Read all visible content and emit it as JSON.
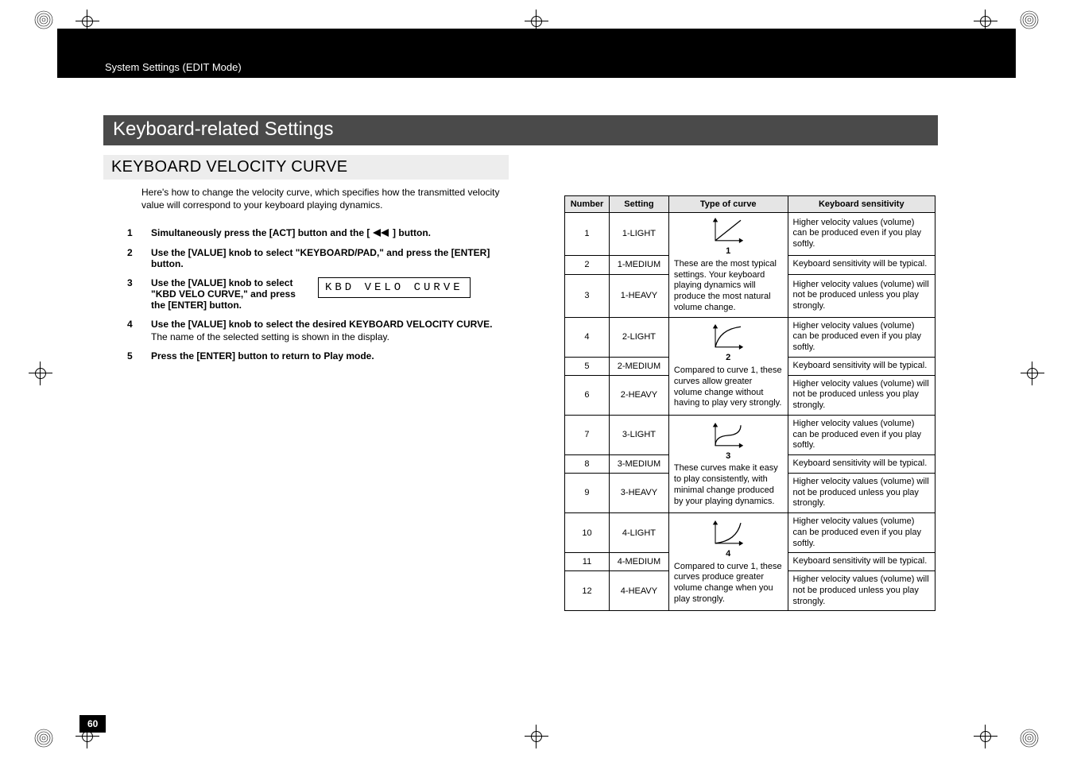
{
  "header": {
    "breadcrumb": "System Settings (EDIT Mode)"
  },
  "title": "Keyboard-related Settings",
  "section": "KEYBOARD VELOCITY CURVE",
  "intro": "Here's how to change the velocity curve, which specifies how the transmitted velocity value will correspond to your keyboard playing dynamics.",
  "steps": {
    "s1": {
      "num": "1",
      "text_a": "Simultaneously press the [ACT] button and the [",
      "text_b": "] button."
    },
    "s2": {
      "num": "2",
      "text": "Use the [VALUE] knob to select \"KEYBOARD/PAD,\" and press the [ENTER] button."
    },
    "s3": {
      "num": "3",
      "text": "Use the [VALUE] knob to select \"KBD VELO CURVE,\" and press the [ENTER] button.",
      "lcd": "KBD VELO CURVE"
    },
    "s4": {
      "num": "4",
      "text": "Use the [VALUE] knob to select the desired KEYBOARD VELOCITY CURVE.",
      "note": "The name of the selected setting is shown in the display."
    },
    "s5": {
      "num": "5",
      "text": "Press the [ENTER] button to return to Play mode."
    }
  },
  "table": {
    "head": {
      "c1": "Number",
      "c2": "Setting",
      "c3": "Type of curve",
      "c4": "Keyboard sensitivity"
    },
    "groups": [
      {
        "curve_num": "1",
        "curve_desc": "These are the most typical settings. Your keyboard playing dynamics will produce the most natural volume change.",
        "curve_shape": "linear",
        "rows": [
          {
            "n": "1",
            "setting": "1-LIGHT",
            "sens": "Higher velocity values (volume) can be produced even if you play softly."
          },
          {
            "n": "2",
            "setting": "1-MEDIUM",
            "sens": "Keyboard sensitivity will be typical."
          },
          {
            "n": "3",
            "setting": "1-HEAVY",
            "sens": "Higher velocity values (volume) will not be produced unless you play strongly."
          }
        ]
      },
      {
        "curve_num": "2",
        "curve_desc": "Compared to curve 1, these curves allow greater volume change without having to play very strongly.",
        "curve_shape": "convex",
        "rows": [
          {
            "n": "4",
            "setting": "2-LIGHT",
            "sens": "Higher velocity values (volume) can be produced even if you play softly."
          },
          {
            "n": "5",
            "setting": "2-MEDIUM",
            "sens": "Keyboard sensitivity will be typical."
          },
          {
            "n": "6",
            "setting": "2-HEAVY",
            "sens": "Higher velocity values (volume) will not be produced unless you play strongly."
          }
        ]
      },
      {
        "curve_num": "3",
        "curve_desc": "These curves make it easy to play consistently, with minimal change produced by your playing dynamics.",
        "curve_shape": "sigmoid",
        "rows": [
          {
            "n": "7",
            "setting": "3-LIGHT",
            "sens": "Higher velocity values (volume) can be produced even if you play softly."
          },
          {
            "n": "8",
            "setting": "3-MEDIUM",
            "sens": "Keyboard sensitivity will be typical."
          },
          {
            "n": "9",
            "setting": "3-HEAVY",
            "sens": "Higher velocity values (volume) will not be produced unless you play strongly."
          }
        ]
      },
      {
        "curve_num": "4",
        "curve_desc": "Compared to curve 1, these curves produce greater volume change when you play strongly.",
        "curve_shape": "concave",
        "rows": [
          {
            "n": "10",
            "setting": "4-LIGHT",
            "sens": "Higher velocity values (volume) can be produced even if you play softly."
          },
          {
            "n": "11",
            "setting": "4-MEDIUM",
            "sens": "Keyboard sensitivity will be typical."
          },
          {
            "n": "12",
            "setting": "4-HEAVY",
            "sens": "Higher velocity values (volume) will not be produced unless you play strongly."
          }
        ]
      }
    ]
  },
  "page_number": "60"
}
